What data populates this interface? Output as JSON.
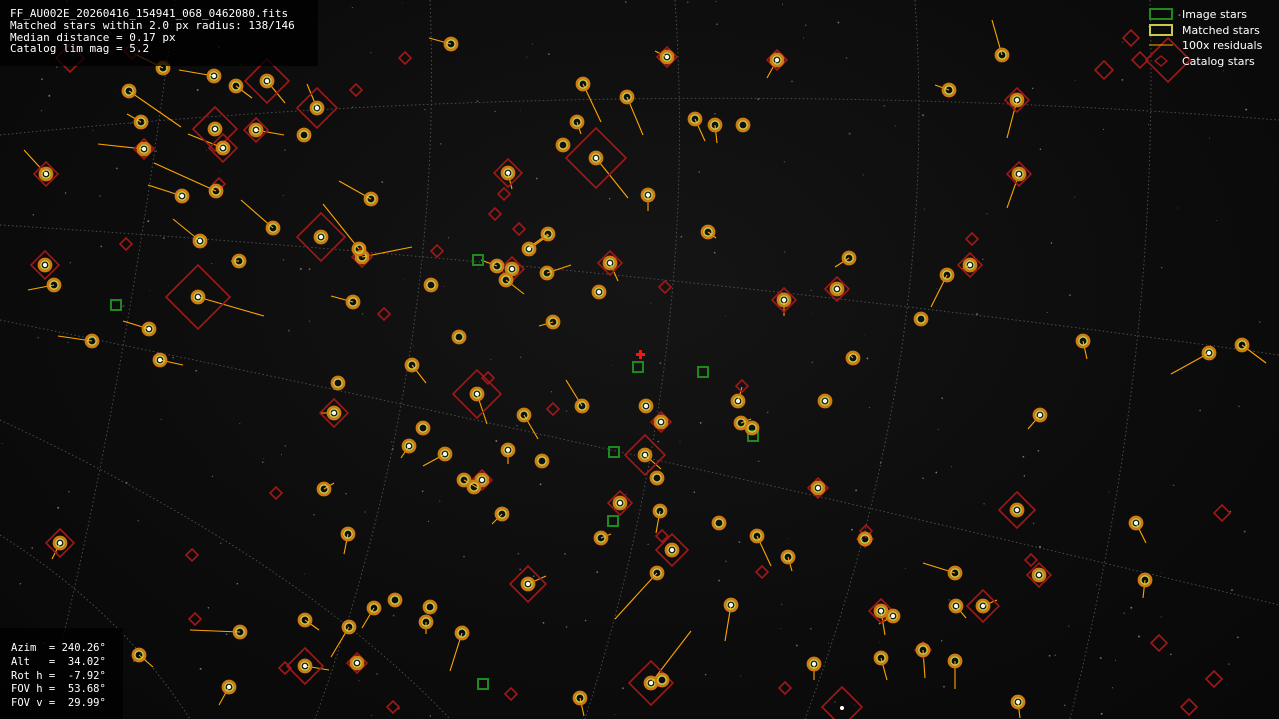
{
  "header_info": {
    "filename": "FF_AU002E_20260416_154941_068_0462080.fits",
    "matched": "Matched stars within 2.0 px radius: 138/146",
    "median": "Median distance = 0.17 px",
    "catalog": "Catalog lim mag = 5.2"
  },
  "legend": {
    "image_stars": "Image stars",
    "matched_stars": "Matched stars",
    "residuals": "100x residuals",
    "catalog_stars": "Catalog stars"
  },
  "pointing": {
    "azim": "Azim  = 240.26°",
    "alt": "Alt   =  34.02°",
    "rot": "Rot h =  -7.92°",
    "fov_h": "FOV h =  53.68°",
    "fov_v": "FOV v =  29.99°"
  },
  "colors": {
    "image_star": "#1e8a1e",
    "matched_ring": "#c9c94a",
    "matched_outer": "#d07a10",
    "residual": "#ffa500",
    "catalog": "#a01818",
    "center_cross": "#ff1010",
    "grid": "#6a6a6a"
  },
  "center_marker_icon": "red-cross-icon"
}
